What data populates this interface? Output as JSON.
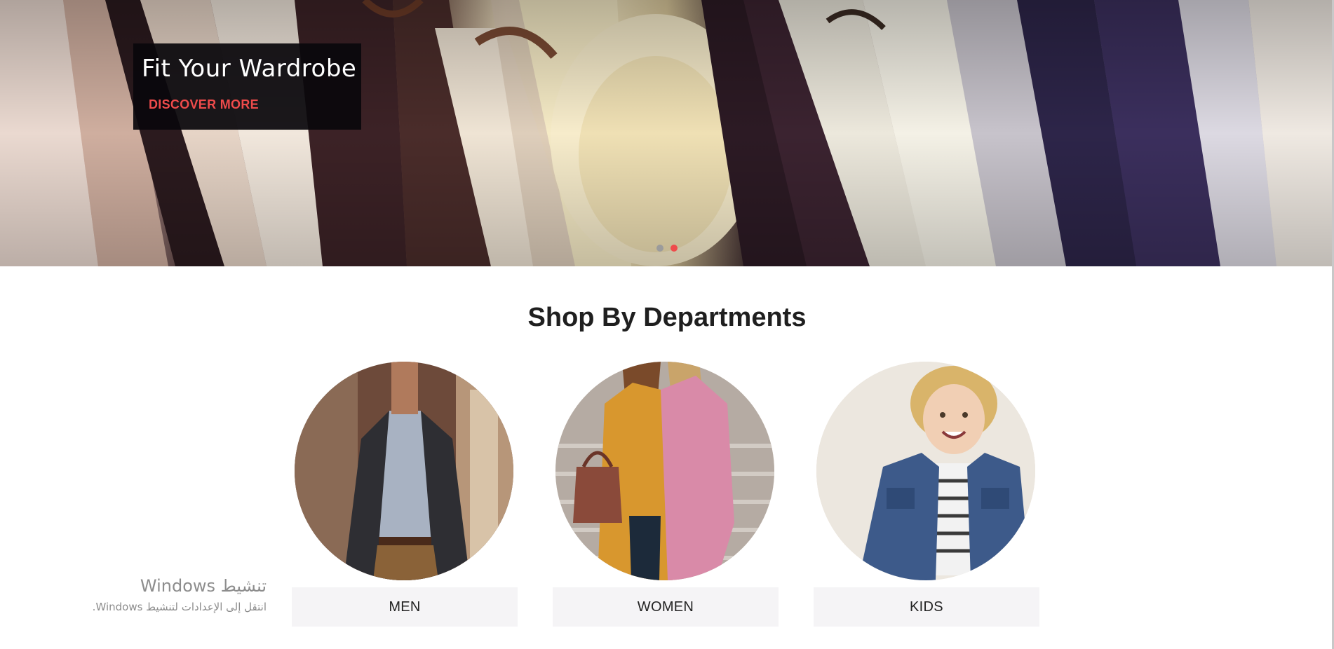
{
  "hero": {
    "title": "Fit Your Wardrobe",
    "cta_label": "DISCOVER MORE",
    "slide_count": 2,
    "active_slide": 2,
    "accent_color": "#ef4b4b"
  },
  "departments": {
    "title": "Shop By Departments",
    "items": [
      {
        "label": "MEN",
        "image": "man-in-blazer-photo"
      },
      {
        "label": "WOMEN",
        "image": "two-women-in-coats-photo"
      },
      {
        "label": "KIDS",
        "image": "boy-in-denim-jacket-photo"
      }
    ]
  },
  "watermark": {
    "title": "تنشيط Windows",
    "subtitle": "انتقل إلى الإعدادات لتنشيط Windows."
  }
}
